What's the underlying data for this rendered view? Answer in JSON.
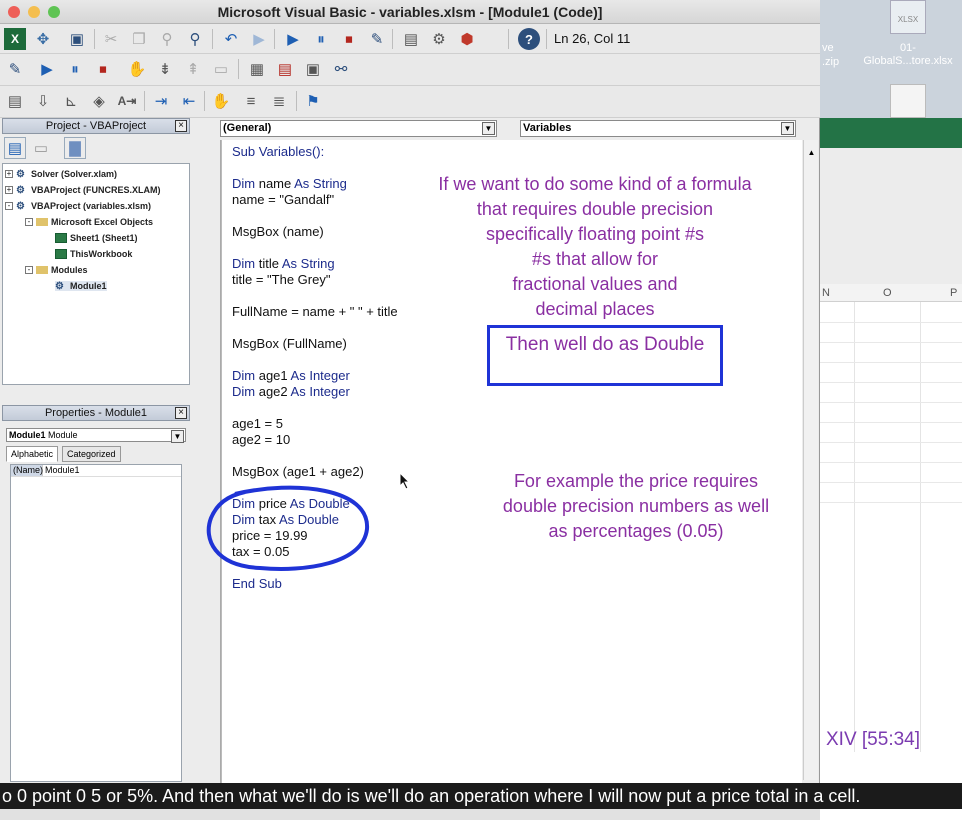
{
  "window": {
    "title": "Microsoft Visual Basic - variables.xlsm - [Module1 (Code)]",
    "cursor_position": "Ln 26, Col 11"
  },
  "desktop": {
    "files": [
      {
        "type_label": "XLSX",
        "name": "01-\nGlobalS...tore.xlsx"
      }
    ],
    "partial_labels": [
      "ve",
      ".zip"
    ]
  },
  "excel": {
    "columns": [
      "N",
      "O",
      "P"
    ],
    "ribbon_color": "#237346"
  },
  "project_panel": {
    "title": "Project - VBAProject",
    "tree": [
      {
        "label": "Solver (Solver.xlam)",
        "expander": "+"
      },
      {
        "label": "VBAProject (FUNCRES.XLAM)",
        "expander": "+"
      },
      {
        "label": "VBAProject (variables.xlsm)",
        "expander": "-"
      },
      {
        "label": "Microsoft Excel Objects",
        "expander": "-"
      },
      {
        "label": "Sheet1 (Sheet1)",
        "expander": ""
      },
      {
        "label": "ThisWorkbook",
        "expander": ""
      },
      {
        "label": "Modules",
        "expander": "-"
      },
      {
        "label": "Module1",
        "expander": ""
      }
    ]
  },
  "properties_panel": {
    "title": "Properties - Module1",
    "object_name": "Module1",
    "object_type": "Module",
    "tabs": [
      "Alphabetic",
      "Categorized"
    ],
    "rows": [
      {
        "key": "(Name)",
        "value": "Module1"
      }
    ]
  },
  "code_window": {
    "object_combo": "(General)",
    "procedure_combo": "Variables",
    "lines": [
      {
        "parts": [
          {
            "t": "Sub Variables():",
            "k": true
          }
        ]
      },
      {
        "parts": [
          {
            "t": "Dim",
            "k": true
          },
          {
            "t": " name "
          },
          {
            "t": "As String",
            "k": true
          }
        ]
      },
      {
        "parts": [
          {
            "t": "name = \"Gandalf\""
          }
        ]
      },
      {
        "parts": [
          {
            "t": "MsgBox (name)"
          }
        ]
      },
      {
        "parts": [
          {
            "t": "Dim",
            "k": true
          },
          {
            "t": " title "
          },
          {
            "t": "As String",
            "k": true
          }
        ]
      },
      {
        "parts": [
          {
            "t": "title = \"The Grey\""
          }
        ]
      },
      {
        "parts": [
          {
            "t": "FullName = name + \" \" + title"
          }
        ]
      },
      {
        "parts": [
          {
            "t": "MsgBox (FullName)"
          }
        ]
      },
      {
        "parts": [
          {
            "t": "Dim",
            "k": true
          },
          {
            "t": " age1 "
          },
          {
            "t": "As Integer",
            "k": true
          }
        ]
      },
      {
        "parts": [
          {
            "t": "Dim",
            "k": true
          },
          {
            "t": " age2 "
          },
          {
            "t": "As Integer",
            "k": true
          }
        ]
      },
      {
        "parts": [
          {
            "t": "age1 = 5"
          }
        ]
      },
      {
        "parts": [
          {
            "t": "age2 = 10"
          }
        ]
      },
      {
        "parts": [
          {
            "t": "MsgBox (age1 + age2)"
          }
        ]
      },
      {
        "parts": [
          {
            "t": "Dim",
            "k": true
          },
          {
            "t": " price "
          },
          {
            "t": "As Double",
            "k": true
          }
        ]
      },
      {
        "parts": [
          {
            "t": "Dim",
            "k": true
          },
          {
            "t": " tax "
          },
          {
            "t": "As Double",
            "k": true
          }
        ]
      },
      {
        "parts": [
          {
            "t": "price = 19.99"
          }
        ]
      },
      {
        "parts": [
          {
            "t": "tax = 0.05"
          }
        ]
      },
      {
        "parts": [
          {
            "t": "End Sub",
            "k": true
          }
        ]
      }
    ]
  },
  "annotations": {
    "note1": [
      "If we want to do some kind of a formula",
      "that requires double precision",
      "specifically floating point #s",
      "#s that allow for",
      "fractional values and",
      "decimal places"
    ],
    "box_text": "Then well do as Double",
    "note2": [
      "For example the price requires",
      "double precision numbers as well",
      "as percentages (0.05)"
    ],
    "color": "#8a2fa2",
    "box_color": "#1f33d6"
  },
  "timecode": "XIV [55:34]",
  "subtitle": "o 0 point 0 5 or 5%. And then what we'll do is we'll do an operation where I will now put a price total in a cell."
}
